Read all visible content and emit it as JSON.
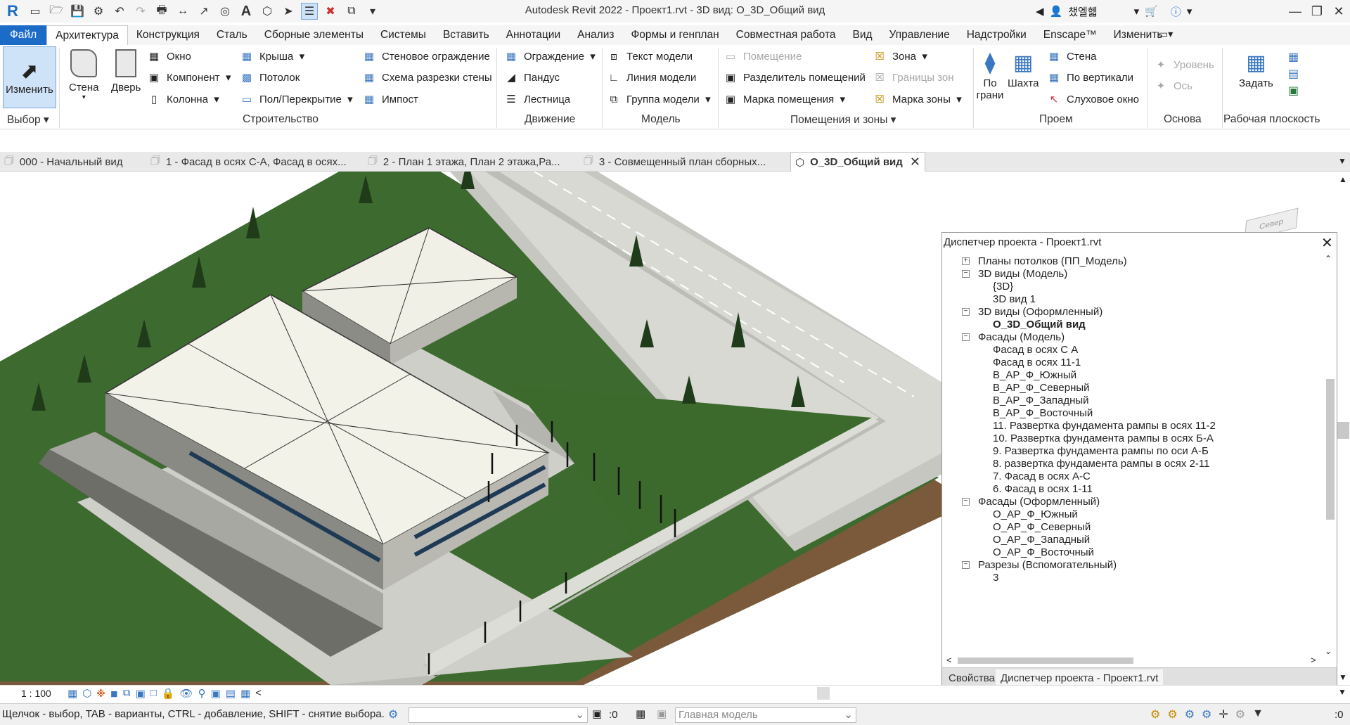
{
  "app": {
    "title": "Autodesk Revit 2022 - Проект1.rvt - 3D вид: О_3D_Общий вид",
    "user": "챘엘헯"
  },
  "menu": {
    "tabs": [
      "Файл",
      "Архитектура",
      "Конструкция",
      "Сталь",
      "Сборные элементы",
      "Системы",
      "Вставить",
      "Аннотации",
      "Анализ",
      "Формы и генплан",
      "Совместная работа",
      "Вид",
      "Управление",
      "Надстройки",
      "Enscape™",
      "Изменить"
    ],
    "active": "Архитектура"
  },
  "ribbon": {
    "select": {
      "modify": "Изменить",
      "group": "Выбор"
    },
    "build": {
      "wall": "Стена",
      "door": "Дверь",
      "window": "Окно",
      "component": "Компонент",
      "column": "Колонна",
      "roof": "Крыша",
      "ceiling": "Потолок",
      "floor": "Пол/Перекрытие",
      "curtain_system": "Стеновое ограждение",
      "curtain_grid": "Схема разрезки стены",
      "mullion": "Импост",
      "group": "Строительство"
    },
    "circulation": {
      "railing": "Ограждение",
      "ramp": "Пандус",
      "stair": "Лестница",
      "group": "Движение"
    },
    "model": {
      "text": "Текст модели",
      "line": "Линия модели",
      "group_model": "Группа модели",
      "group": "Модель"
    },
    "rooms": {
      "room": "Помещение",
      "separator": "Разделитель помещений",
      "tag": "Марка помещения",
      "area": "Зона",
      "area_boundary": "Границы зон",
      "area_tag": "Марка зоны",
      "group": "Помещения и зоны"
    },
    "opening": {
      "by_face": "По грани",
      "shaft": "Шахта",
      "wall": "Стена",
      "vertical": "По вертикали",
      "dormer": "Слуховое окно",
      "group": "Проем"
    },
    "datum": {
      "level": "Уровень",
      "grid": "Ось",
      "group": "Основа"
    },
    "workplane": {
      "set": "Задать",
      "group": "Рабочая плоскость"
    }
  },
  "view_tabs": [
    "000 - Начальный вид",
    "1 - Фасад в осях С-А, Фасад в осях...",
    "2 - План 1 этажа, План 2 этажа,Ра...",
    "3 - Совмещенный план сборных...",
    "О_3D_Общий вид"
  ],
  "viewcube": {
    "face": "Север"
  },
  "project_browser": {
    "title": "Диспетчер проекта - Проект1.rvt",
    "items": [
      {
        "label": "Планы потолков (ПП_Модель)",
        "level": 0,
        "toggle": "+"
      },
      {
        "label": "3D виды (Модель)",
        "level": 0,
        "toggle": "−"
      },
      {
        "label": "{3D}",
        "level": 1
      },
      {
        "label": "3D вид 1",
        "level": 1
      },
      {
        "label": "3D виды (Оформленный)",
        "level": 0,
        "toggle": "−"
      },
      {
        "label": "О_3D_Общий вид",
        "level": 1,
        "selected": true
      },
      {
        "label": "Фасады (Модель)",
        "level": 0,
        "toggle": "−"
      },
      {
        "label": "Фасад в осях С А",
        "level": 1
      },
      {
        "label": "Фасад в осях 11-1",
        "level": 1
      },
      {
        "label": "В_АР_Ф_Южный",
        "level": 1
      },
      {
        "label": "В_АР_Ф_Северный",
        "level": 1
      },
      {
        "label": "В_АР_Ф_Западный",
        "level": 1
      },
      {
        "label": "В_АР_Ф_Восточный",
        "level": 1
      },
      {
        "label": "11. Развертка фундамента рампы в осях 11-2",
        "level": 1
      },
      {
        "label": "10. Развертка фундамента рампы в осях Б-А",
        "level": 1
      },
      {
        "label": "9. Развертка фундамента рампы по оси А-Б",
        "level": 1
      },
      {
        "label": "8. развертка фундамента рампы в осях 2-11",
        "level": 1
      },
      {
        "label": "7. Фасад в осях А-С",
        "level": 1
      },
      {
        "label": "6. Фасад в осях 1-11",
        "level": 1
      },
      {
        "label": "Фасады (Оформленный)",
        "level": 0,
        "toggle": "−"
      },
      {
        "label": "О_АР_Ф_Южный",
        "level": 1
      },
      {
        "label": "О_АР_Ф_Северный",
        "level": 1
      },
      {
        "label": "О_АР_Ф_Западный",
        "level": 1
      },
      {
        "label": "О_АР_Ф_Восточный",
        "level": 1
      },
      {
        "label": "Разрезы (Вспомогательный)",
        "level": 0,
        "toggle": "−"
      },
      {
        "label": "3",
        "level": 1
      }
    ],
    "tabs": [
      "Свойства",
      "Диспетчер проекта - Проект1.rvt"
    ]
  },
  "view_control": {
    "scale": "1 : 100"
  },
  "status": {
    "hint": "Щелчок - выбор, TAB - варианты, CTRL - добавление, SHIFT - снятие выбора.",
    "count": ":0",
    "model": "Главная модель",
    "filter_count": ":0"
  }
}
